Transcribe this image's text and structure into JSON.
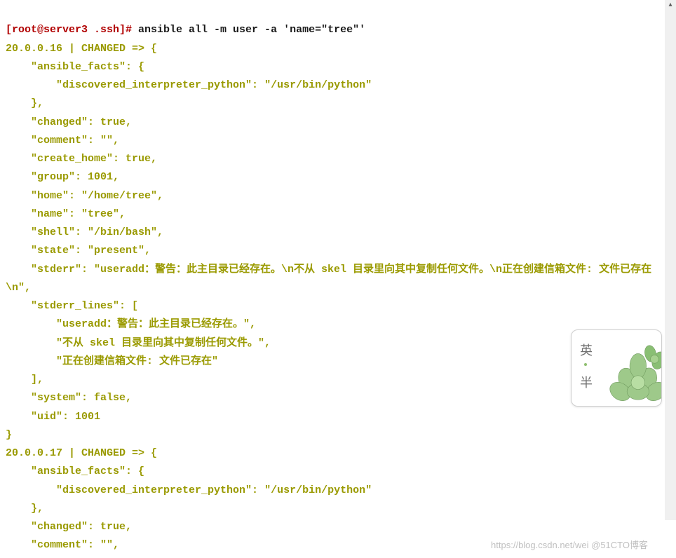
{
  "prompt": {
    "prefix": "[root@server3 .ssh]#",
    "command": " ansible all -m user -a 'name=\"tree\"'"
  },
  "result1": {
    "header_host": "20.0.0.16",
    "header_sep": " | ",
    "header_status": "CHANGED",
    "header_arrow": " => {",
    "ansible_facts_key": "    \"ansible_facts\": {",
    "interp_line": "        \"discovered_interpreter_python\": \"/usr/bin/python\"",
    "facts_close": "    },",
    "changed": "    \"changed\": true,",
    "comment": "    \"comment\": \"\",",
    "create_home": "    \"create_home\": true,",
    "group": "    \"group\": 1001,",
    "home": "    \"home\": \"/home/tree\",",
    "name": "    \"name\": \"tree\",",
    "shell": "    \"shell\": \"/bin/bash\",",
    "state": "    \"state\": \"present\",",
    "stderr": "    \"stderr\": \"useradd：警告：此主目录已经存在。\\n不从 skel 目录里向其中复制任何文件。\\n正在创建信箱文件: 文件已存在\\n\",",
    "stderr_lines_key": "    \"stderr_lines\": [",
    "sl1": "        \"useradd：警告：此主目录已经存在。\",",
    "sl2": "        \"不从 skel 目录里向其中复制任何文件。\",",
    "sl3": "        \"正在创建信箱文件: 文件已存在\"",
    "sl_close": "    ],",
    "system": "    \"system\": false,",
    "uid": "    \"uid\": 1001",
    "close": "}"
  },
  "result2": {
    "header_host": "20.0.0.17",
    "header_sep": " | ",
    "header_status": "CHANGED",
    "header_arrow": " => {",
    "ansible_facts_key": "    \"ansible_facts\": {",
    "interp_line": "        \"discovered_interpreter_python\": \"/usr/bin/python\"",
    "facts_close": "    },",
    "changed": "    \"changed\": true,",
    "comment": "    \"comment\": \"\","
  },
  "sticker": {
    "char1": "英",
    "char2": "半"
  },
  "watermark": "https://blog.csdn.net/wei  @51CTO博客"
}
